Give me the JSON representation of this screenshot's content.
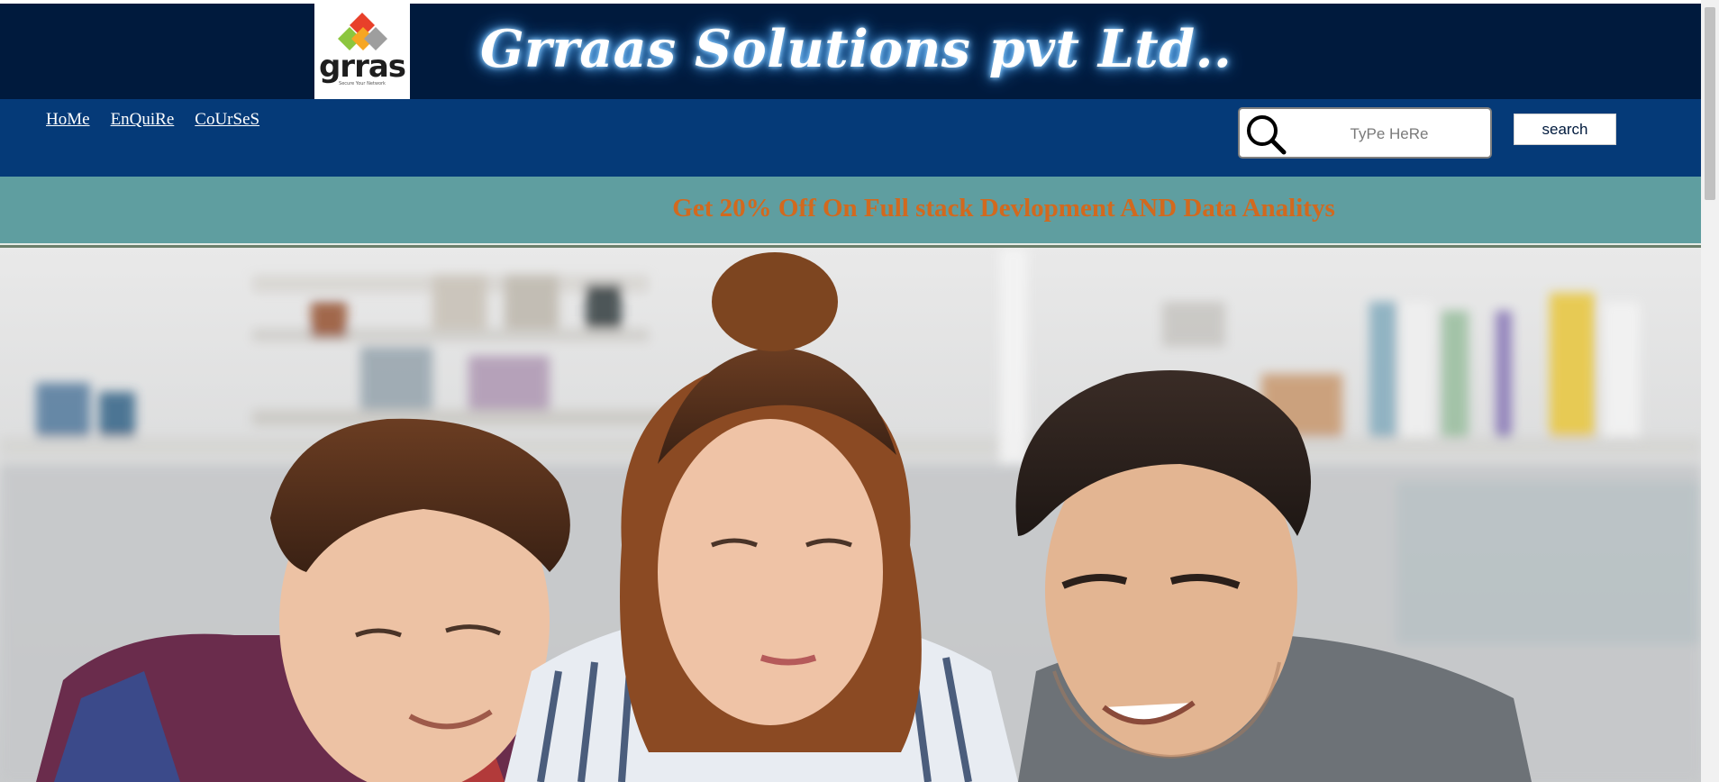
{
  "header": {
    "logo": {
      "wordmark": "grras",
      "tagline": "Secure Your Network"
    },
    "title": "Grraas Solutions pvt Ltd.."
  },
  "nav": {
    "links": [
      {
        "label": "HoMe"
      },
      {
        "label": "EnQuiRe"
      },
      {
        "label": "CoUrSeS"
      }
    ]
  },
  "search": {
    "placeholder": "TyPe HeRe",
    "value": "",
    "button_label": "search"
  },
  "offer": {
    "text": "Get 20% Off On Full stack Devlopment AND Data Analitys"
  },
  "hero": {
    "alt": "Three students looking at a laptop"
  },
  "colors": {
    "header_bg": "#001a3d",
    "nav_bg": "#053a78",
    "offer_bg": "#5f9ea0",
    "offer_text": "#d2691e",
    "title_glow": "#5fb4ff"
  },
  "icons": [
    "search-icon",
    "logo-diamonds-icon"
  ]
}
